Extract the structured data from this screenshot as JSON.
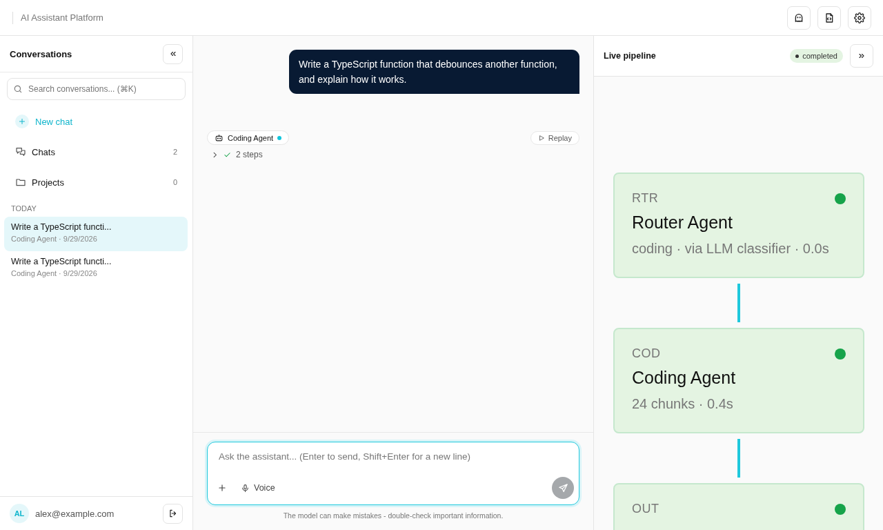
{
  "header": {
    "title": "AI Assistant Platform"
  },
  "sidebar": {
    "title": "Conversations",
    "search": {
      "placeholder": "Search conversations... (⌘K)"
    },
    "new_chat": "New chat",
    "nav": [
      {
        "kind": "chats",
        "label": "Chats",
        "count": "2"
      },
      {
        "kind": "projects",
        "label": "Projects",
        "count": "0"
      }
    ],
    "section": "TODAY",
    "conversations": [
      {
        "title": "Write a TypeScript functi...",
        "meta": "Coding Agent · 9/29/2026",
        "selected": true
      },
      {
        "title": "Write a TypeScript functi...",
        "meta": "Coding Agent · 9/29/2026",
        "selected": false
      }
    ],
    "user": {
      "initials": "AL",
      "email": "alex@example.com"
    }
  },
  "chat": {
    "user_message": "Write a TypeScript function that debounces another function, and explain how it works.",
    "agent": {
      "name": "Coding Agent",
      "active": true
    },
    "replay": "Replay",
    "steps": {
      "label": "2 steps",
      "expanded": false,
      "done": true
    },
    "composer": {
      "placeholder": "Ask the assistant... (Enter to send, Shift+Enter for a new line)",
      "voice": "Voice"
    },
    "disclaimer": "The model can make mistakes - double-check important information."
  },
  "pipeline": {
    "title": "Live pipeline",
    "status": "completed",
    "nodes": [
      {
        "code": "RTR",
        "title": "Router Agent",
        "detail": "coding · via LLM classifier · 0.0s",
        "color": "#16a34a"
      },
      {
        "code": "COD",
        "title": "Coding Agent",
        "detail": "24 chunks · 0.4s",
        "color": "#16a34a"
      },
      {
        "code": "OUT",
        "color": "#16a34a"
      }
    ]
  }
}
